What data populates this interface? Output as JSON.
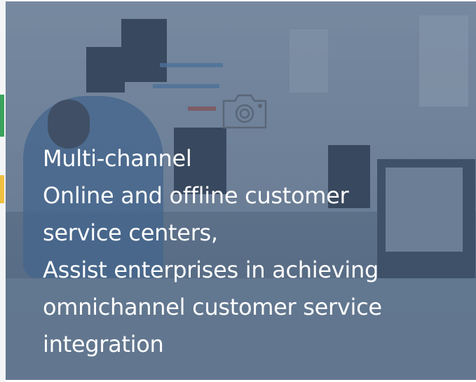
{
  "banner": {
    "icon": "camera-icon",
    "lines": [
      "Multi-channel",
      "Online and offline customer",
      "service centers,",
      "Assist enterprises in achieving",
      "omnichannel customer service",
      "integration"
    ]
  },
  "colors": {
    "overlay": "#465f7d",
    "text": "#ffffff"
  }
}
